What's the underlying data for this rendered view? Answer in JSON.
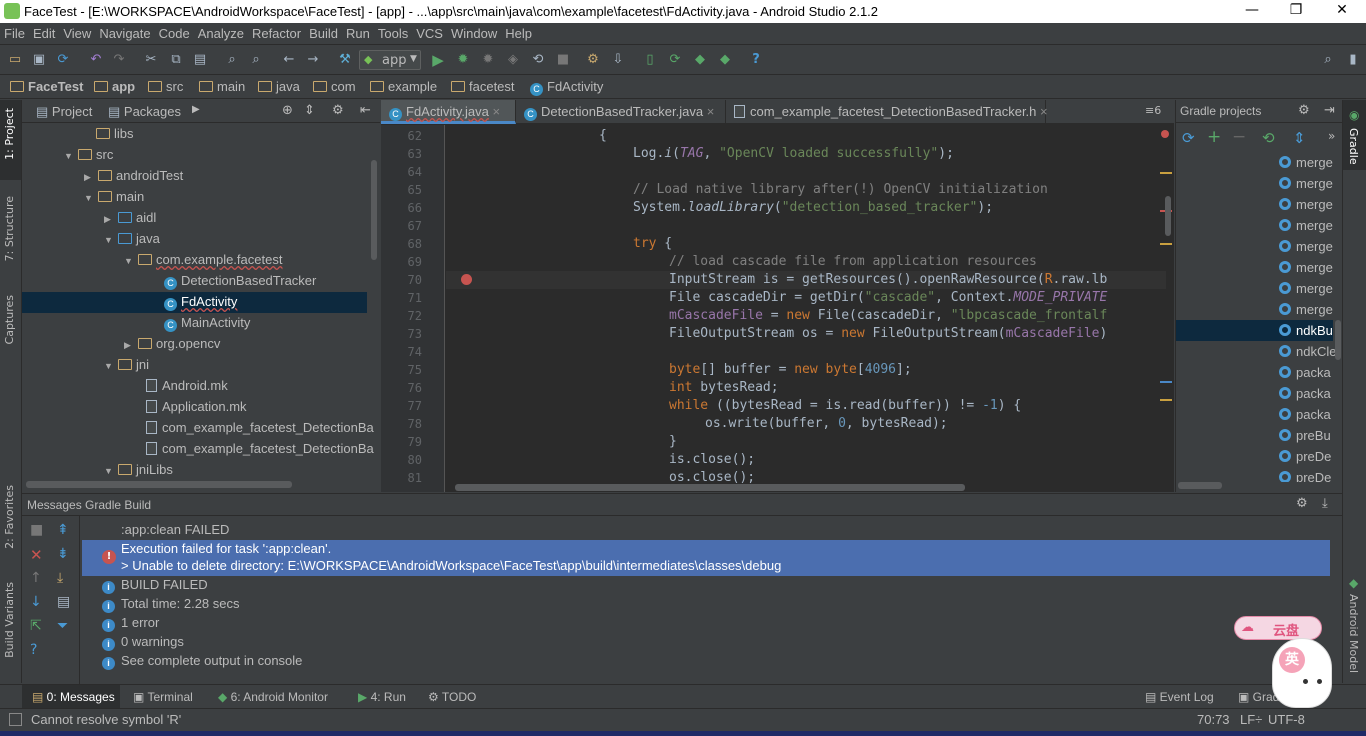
{
  "window": {
    "title": "FaceTest - [E:\\WORKSPACE\\AndroidWorkspace\\FaceTest] - [app] - ...\\app\\src\\main\\java\\com\\example\\facetest\\FdActivity.java - Android Studio 2.1.2",
    "minimize": "—",
    "restore": "❐",
    "close": "✕"
  },
  "menu": [
    "File",
    "Edit",
    "View",
    "Navigate",
    "Code",
    "Analyze",
    "Refactor",
    "Build",
    "Run",
    "Tools",
    "VCS",
    "Window",
    "Help"
  ],
  "toolbar": {
    "run_config": "app",
    "help": "?"
  },
  "breadcrumb": [
    "FaceTest",
    "app",
    "src",
    "main",
    "java",
    "com",
    "example",
    "facetest",
    "FdActivity"
  ],
  "left_strip": {
    "project": "1: Project",
    "structure": "7: Structure",
    "captures": "Captures",
    "favorites": "2: Favorites",
    "build_variants": "Build Variants"
  },
  "project_panel": {
    "tabs": [
      "Project",
      "Packages"
    ],
    "tree": [
      {
        "label": "libs",
        "type": "folder",
        "arrow": ""
      },
      {
        "label": "src",
        "type": "folder",
        "arrow": "▼"
      },
      {
        "label": "androidTest",
        "type": "folder",
        "arrow": "▶"
      },
      {
        "label": "main",
        "type": "folder",
        "arrow": "▼"
      },
      {
        "label": "aidl",
        "type": "folder",
        "arrow": "▶"
      },
      {
        "label": "java",
        "type": "folder",
        "arrow": "▼"
      },
      {
        "label": "com.example.facetest",
        "type": "package",
        "arrow": "▼"
      },
      {
        "label": "DetectionBasedTracker",
        "type": "class",
        "arrow": ""
      },
      {
        "label": "FdActivity",
        "type": "class",
        "arrow": "",
        "selected": true
      },
      {
        "label": "MainActivity",
        "type": "class",
        "arrow": ""
      },
      {
        "label": "org.opencv",
        "type": "package",
        "arrow": "▶"
      },
      {
        "label": "jni",
        "type": "folder",
        "arrow": "▼"
      },
      {
        "label": "Android.mk",
        "type": "file",
        "arrow": ""
      },
      {
        "label": "Application.mk",
        "type": "file",
        "arrow": ""
      },
      {
        "label": "com_example_facetest_DetectionBa",
        "type": "file",
        "arrow": ""
      },
      {
        "label": "com_example_facetest_DetectionBa",
        "type": "file",
        "arrow": ""
      },
      {
        "label": "jniLibs",
        "type": "folder",
        "arrow": "▼"
      }
    ]
  },
  "editor": {
    "tabs": [
      {
        "label": "FdActivity.java",
        "close": "×",
        "active": true
      },
      {
        "label": "DetectionBasedTracker.java",
        "close": "×"
      },
      {
        "label": "com_example_facetest_DetectionBasedTracker.h",
        "close": "×"
      }
    ],
    "tab_overflow": "≡6",
    "lines": [
      "62",
      "63",
      "64",
      "65",
      "66",
      "67",
      "68",
      "69",
      "70",
      "71",
      "72",
      "73",
      "74",
      "75",
      "76",
      "77",
      "78",
      "79",
      "80",
      "81"
    ],
    "code_text": {
      "l62": "{",
      "l63a": "Log.",
      "l63b": "i",
      "l63c": "(",
      "l63d": "TAG",
      "l63e": ", ",
      "l63f": "\"OpenCV loaded successfully\"",
      "l63g": ");",
      "l65": "// Load native library after(!) OpenCV initialization",
      "l66a": "System.",
      "l66b": "loadLibrary",
      "l66c": "(",
      "l66d": "\"detection_based_tracker\"",
      "l66e": ");",
      "l68a": "try",
      "l68b": " {",
      "l69": "// load cascade file from application resources",
      "l70a": "InputStream is = getResources().openRawResource(",
      "l70b": "R",
      "l70c": ".raw.lb",
      "l71a": "File cascadeDir = getDir(",
      "l71b": "\"cascade\"",
      "l71c": ", Context.",
      "l71d": "MODE_PRIVATE",
      "l72a": "mCascadeFile",
      "l72b": " = ",
      "l72c": "new",
      "l72d": " File(cascadeDir, ",
      "l72e": "\"lbpcascade_frontalf",
      "l73a": "FileOutputStream os = ",
      "l73b": "new",
      "l73c": " FileOutputStream(",
      "l73d": "mCascadeFile",
      "l73e": ")",
      "l75a": "byte",
      "l75b": "[] buffer = ",
      "l75c": "new",
      "l75d": " byte",
      "l75e": "[",
      "l75f": "4096",
      "l75g": "];",
      "l76a": "int",
      "l76b": " bytesRead;",
      "l77a": "while",
      "l77b": " ((bytesRead = is.read(buffer)) != ",
      "l77c": "-1",
      "l77d": ") {",
      "l78a": "os.write(buffer, ",
      "l78b": "0",
      "l78c": ", bytesRead);",
      "l79": "}",
      "l80": "is.close();",
      "l81": "os.close();"
    }
  },
  "gradle_panel": {
    "title": "Gradle projects",
    "items": [
      "merge",
      "merge",
      "merge",
      "merge",
      "merge",
      "merge",
      "merge",
      "merge",
      "ndkBu",
      "ndkCle",
      "packa",
      "packa",
      "packa",
      "preBu",
      "preDe",
      "preDe"
    ]
  },
  "right_strip": {
    "gradle": "Gradle",
    "android_model": "Android Model"
  },
  "messages": {
    "title": "Messages Gradle Build",
    "rows": [
      {
        "text": ":app:clean FAILED",
        "icon": ""
      },
      {
        "text": "Execution failed for task ':app:clean'.",
        "icon": "error",
        "selected": true
      },
      {
        "text": "> Unable to delete directory: E:\\WORKSPACE\\AndroidWorkspace\\FaceTest\\app\\build\\intermediates\\classes\\debug",
        "icon": "",
        "selected": true
      },
      {
        "text": "BUILD FAILED",
        "icon": "info"
      },
      {
        "text": "Total time: 2.28 secs",
        "icon": "info"
      },
      {
        "text": "1 error",
        "icon": "info"
      },
      {
        "text": "0 warnings",
        "icon": "info"
      },
      {
        "text": "See complete output in console",
        "icon": "info"
      }
    ]
  },
  "bottom_tabs": {
    "messages": "0: Messages",
    "terminal": "Terminal",
    "android_monitor": "6: Android Monitor",
    "run": "4: Run",
    "todo": "TODO",
    "event_log": "Event Log",
    "gradle_console": "Gradle"
  },
  "status": {
    "message": "Cannot resolve symbol 'R'",
    "position": "70:73",
    "line_sep": "LF÷",
    "encoding": "UTF-8"
  },
  "overlay": {
    "badge": "云盘",
    "icon": "英"
  },
  "colors": {
    "accent": "#4a88c7",
    "selection": "#4b6eaf",
    "error": "#c75450",
    "bg": "#3c3f41",
    "editor_bg": "#2b2b2b"
  }
}
